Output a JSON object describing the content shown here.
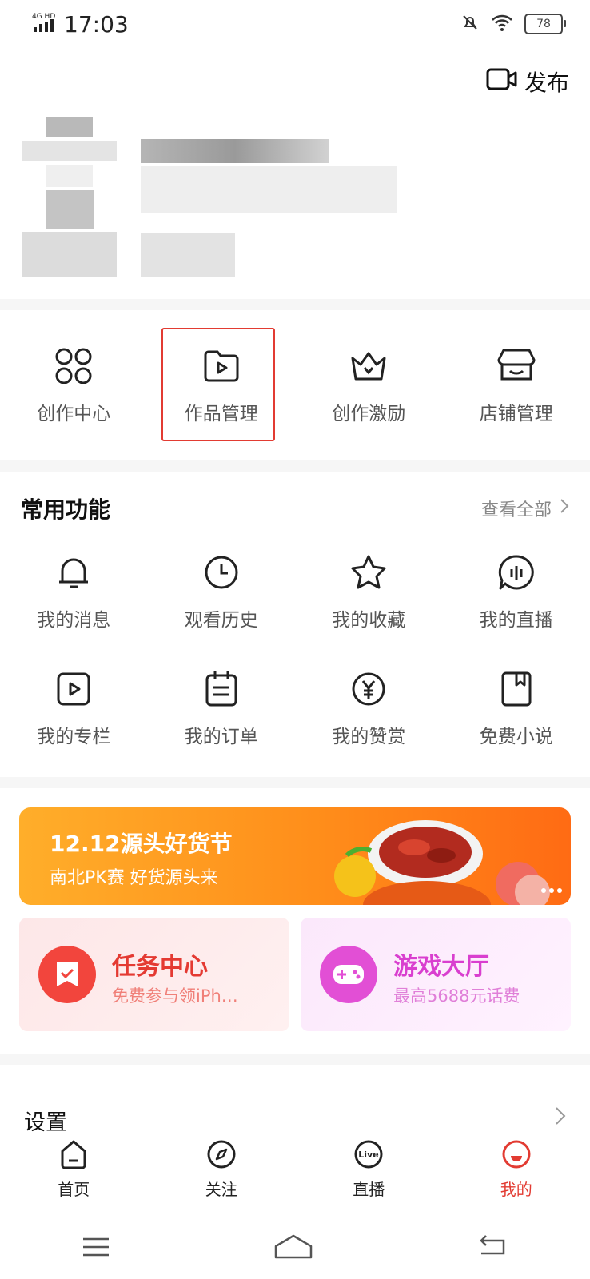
{
  "status": {
    "network": "4G HD",
    "time": "17:03",
    "battery": "78"
  },
  "header": {
    "publish_label": "发布"
  },
  "creator": [
    {
      "label": "创作中心",
      "icon": "grid-icon"
    },
    {
      "label": "作品管理",
      "icon": "folder-play-icon"
    },
    {
      "label": "创作激励",
      "icon": "crown-icon"
    },
    {
      "label": "店铺管理",
      "icon": "store-icon"
    }
  ],
  "common": {
    "title": "常用功能",
    "see_all": "查看全部",
    "row1": [
      {
        "label": "我的消息",
        "icon": "bell-icon"
      },
      {
        "label": "观看历史",
        "icon": "clock-icon"
      },
      {
        "label": "我的收藏",
        "icon": "star-icon"
      },
      {
        "label": "我的直播",
        "icon": "live-icon"
      }
    ],
    "row2": [
      {
        "label": "我的专栏",
        "icon": "play-square-icon"
      },
      {
        "label": "我的订单",
        "icon": "order-icon"
      },
      {
        "label": "我的赞赏",
        "icon": "yen-icon"
      },
      {
        "label": "免费小说",
        "icon": "book-icon"
      }
    ]
  },
  "banner": {
    "title": "12.12源头好货节",
    "subtitle": "南北PK赛 好货源头来"
  },
  "cards": {
    "task": {
      "title": "任务中心",
      "subtitle": "免费参与领iPh…"
    },
    "game": {
      "title": "游戏大厅",
      "subtitle": "最高5688元话费"
    }
  },
  "settings_label": "设置",
  "tabs": [
    {
      "label": "首页",
      "icon": "home-icon"
    },
    {
      "label": "关注",
      "icon": "compass-icon"
    },
    {
      "label": "直播",
      "icon": "live-badge-icon"
    },
    {
      "label": "我的",
      "icon": "profile-icon"
    }
  ],
  "colors": {
    "accent_red": "#e23b32",
    "banner_orange": "#ff8d1a",
    "game_pink": "#e24fd5"
  }
}
